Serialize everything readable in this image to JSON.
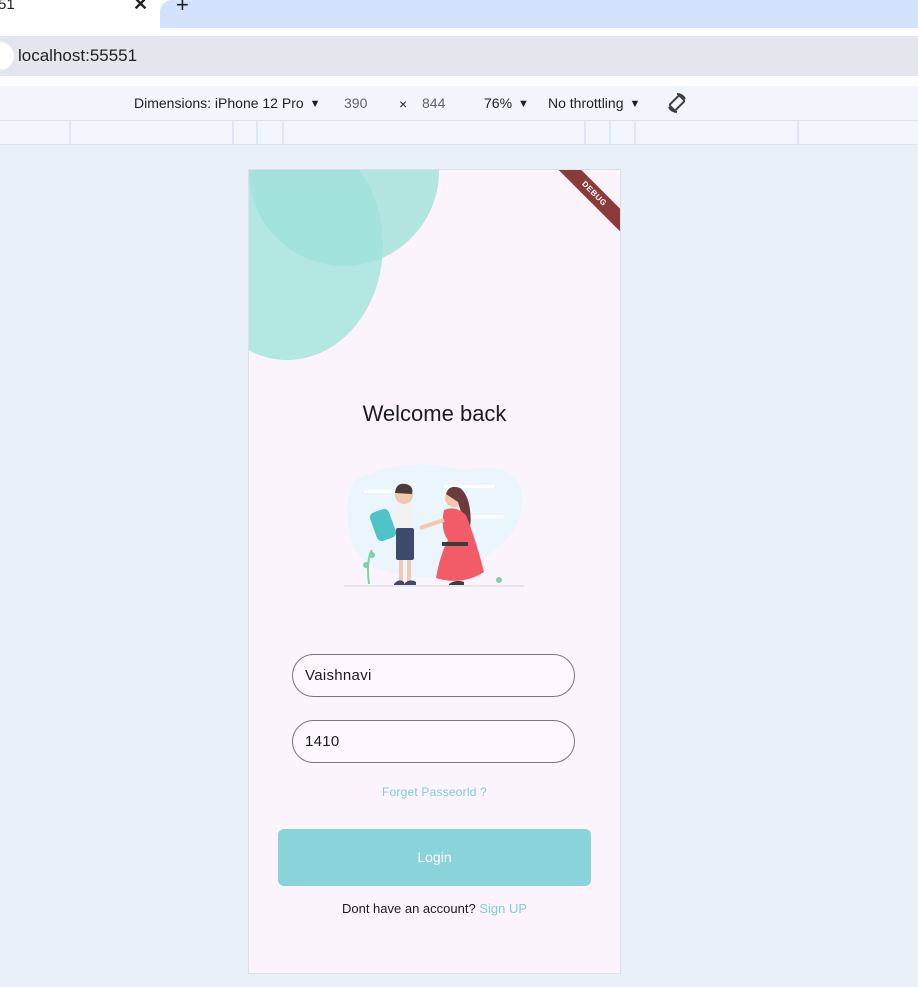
{
  "browser": {
    "tab_title": "51",
    "close_glyph": "✕",
    "new_tab_glyph": "+",
    "url": "localhost:55551"
  },
  "devtools": {
    "device_label": "Dimensions: iPhone 12 Pro",
    "width": "390",
    "times": "×",
    "height": "844",
    "zoom": "76%",
    "throttling": "No throttling",
    "rotate_icon": "rotate-icon"
  },
  "app": {
    "debug_banner": "DEBUG",
    "welcome_title": "Welcome back",
    "username_value": "Vaishnavi",
    "password_value": "1410",
    "forgot_label": "Forget Passeorld ?",
    "login_label": "Login",
    "signup_prompt": "Dont have an account?",
    "signup_link": "Sign UP",
    "colors": {
      "accent": "#89d3da",
      "link": "#7fcdd6",
      "blob": "#a5e4dd",
      "background": "#fcf4fd"
    }
  }
}
